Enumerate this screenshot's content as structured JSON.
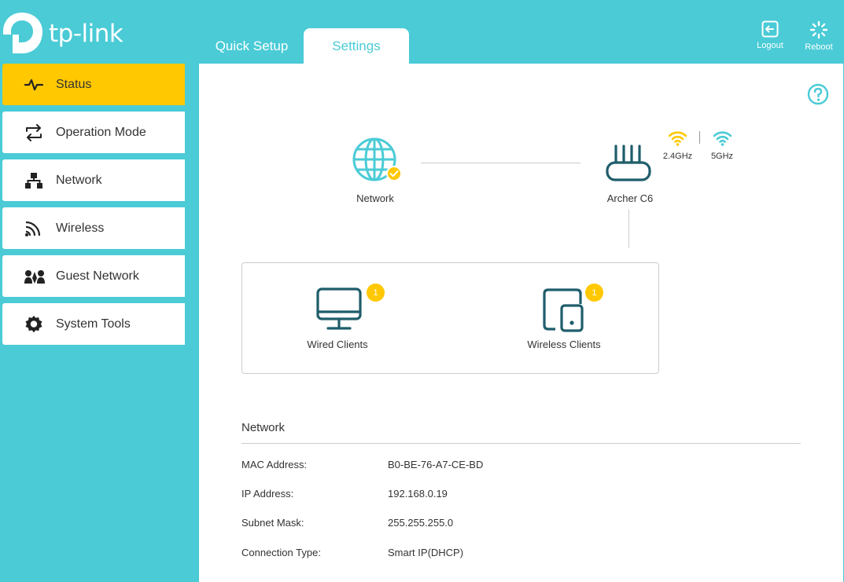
{
  "brand": {
    "name": "tp-link"
  },
  "tabs": [
    {
      "label": "Quick Setup"
    },
    {
      "label": "Settings"
    }
  ],
  "header_buttons": {
    "logout": "Logout",
    "reboot": "Reboot"
  },
  "sidebar": {
    "items": [
      {
        "label": "Status",
        "icon": "pulse-icon"
      },
      {
        "label": "Operation Mode",
        "icon": "swap-icon"
      },
      {
        "label": "Network",
        "icon": "network-icon"
      },
      {
        "label": "Wireless",
        "icon": "wireless-icon"
      },
      {
        "label": "Guest Network",
        "icon": "guest-icon"
      },
      {
        "label": "System Tools",
        "icon": "gear-icon"
      }
    ]
  },
  "topology": {
    "network_label": "Network",
    "router_label": "Archer C6",
    "band_24": "2.4GHz",
    "band_5": "5GHz",
    "wired": {
      "label": "Wired Clients",
      "count": "1"
    },
    "wireless": {
      "label": "Wireless Clients",
      "count": "1"
    }
  },
  "network_info": {
    "title": "Network",
    "rows": [
      {
        "label": "MAC Address:",
        "value": "B0-BE-76-A7-CE-BD"
      },
      {
        "label": "IP Address:",
        "value": "192.168.0.19"
      },
      {
        "label": "Subnet Mask:",
        "value": "255.255.255.0"
      },
      {
        "label": "Connection Type:",
        "value": "Smart IP(DHCP)"
      }
    ]
  },
  "colors": {
    "accent": "#4acbd6",
    "active": "#ffc800",
    "icon_dark": "#1f5d6b"
  }
}
